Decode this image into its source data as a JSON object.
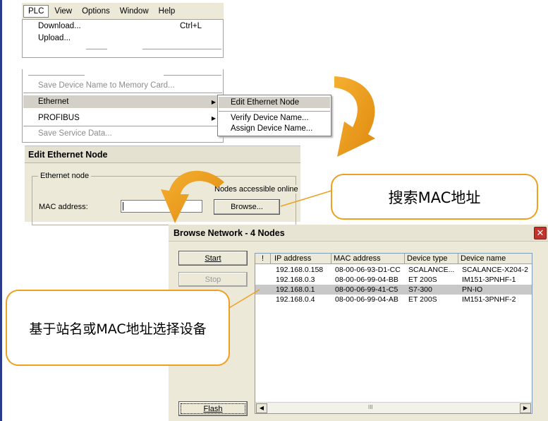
{
  "menubar": {
    "items": [
      "PLC",
      "View",
      "Options",
      "Window",
      "Help"
    ]
  },
  "plc_menu": {
    "download": "Download...",
    "download_shortcut": "Ctrl+L",
    "upload": "Upload...",
    "save_device_name": "Save Device Name to Memory Card...",
    "ethernet": "Ethernet",
    "profibus": "PROFIBUS",
    "save_service_data": "Save Service Data..."
  },
  "ethernet_submenu": {
    "edit_node": "Edit Ethernet Node",
    "verify_name": "Verify Device Name...",
    "assign_name": "Assign Device Name..."
  },
  "edit_ethernet_node": {
    "title": "Edit Ethernet Node",
    "group_label": "Ethernet node",
    "accessible_label": "Nodes accessible online",
    "mac_label": "MAC address:",
    "mac_value": "",
    "browse_button": "Browse..."
  },
  "browse_network": {
    "title": "Browse Network - 4 Nodes",
    "close_glyph": "✕",
    "start_button": "Start",
    "stop_button": "Stop",
    "flash_button": "Flash",
    "columns": [
      "!",
      "IP address",
      "MAC address",
      "Device type",
      "Device name"
    ],
    "rows": [
      {
        "ip": "192.168.0.158",
        "mac": "08-00-06-93-D1-CC",
        "type": "SCALANCE...",
        "name": "SCALANCE-X204-2",
        "selected": false
      },
      {
        "ip": "192.168.0.3",
        "mac": "08-00-06-99-04-BB",
        "type": "ET 200S",
        "name": "IM151-3PNHF-1",
        "selected": false
      },
      {
        "ip": "192.168.0.1",
        "mac": "08-00-06-99-41-C5",
        "type": "S7-300",
        "name": "PN-IO",
        "selected": true
      },
      {
        "ip": "192.168.0.4",
        "mac": "08-00-06-99-04-AB",
        "type": "ET 200S",
        "name": "IM151-3PNHF-2",
        "selected": false
      }
    ],
    "scroll_left": "◀",
    "scroll_right": "▶",
    "scroll_thumb": "III"
  },
  "callouts": {
    "search_mac": "搜索MAC地址",
    "select_device": "基于站名或MAC地址选择设备"
  },
  "colors": {
    "accent_orange": "#f0a020",
    "dialog_bg": "#ece9d8",
    "selection": "#c8c8c8"
  }
}
